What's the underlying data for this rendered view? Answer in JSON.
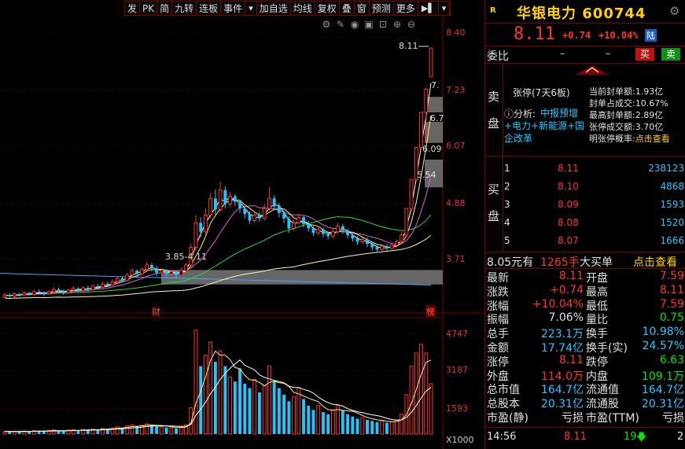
{
  "toolbar": [
    "发",
    "PK",
    "简",
    "九转",
    "连板",
    "事件",
    "▾",
    "加自选",
    "均线",
    "复权",
    "叠",
    "窗",
    "预测",
    "更多",
    "▶▌",
    "▾"
  ],
  "price_axis": [
    "8.40",
    "7.23",
    "6.07",
    "4.88",
    "3.71"
  ],
  "volume_axis": [
    "4747",
    "3187",
    "1593",
    "X1000"
  ],
  "annotations": {
    "peak_price": "8.11",
    "box_label": "3.85-4.11",
    "cai_marker": "财",
    "bang_marker": "榜",
    "labels_right": [
      "7.",
      "6.7",
      "6.09",
      "5.54"
    ]
  },
  "header": {
    "badge": "R",
    "title": "华银电力 600744",
    "price": "8.11",
    "change": "+0.74",
    "change_pct": "+10.04%",
    "board_tag": "陆"
  },
  "weibi": {
    "label": "委比",
    "v1": "–",
    "v2": "–",
    "buy": "买",
    "sell": "卖"
  },
  "sell_panel": {
    "side": [
      "卖",
      "盘"
    ],
    "limit_title": "张停(7天6板)",
    "analysis_prefix": "ⓘ分析:",
    "analysis_text": "中报预增+电力+新能源+国企改革",
    "metrics": [
      {
        "k": "当前封单额",
        "v": "1.93亿"
      },
      {
        "k": "封单占成交",
        "v": "10.67%"
      },
      {
        "k": "最高封单额",
        "v": "2.89亿"
      },
      {
        "k": "张停成交额",
        "v": "3.70亿"
      },
      {
        "k": "明张停概率",
        "v": "点击查看"
      }
    ]
  },
  "buy_panel": {
    "side": [
      "买",
      "盘"
    ],
    "rows": [
      {
        "level": "1",
        "price": "8.11",
        "vol": "238123"
      },
      {
        "level": "2",
        "price": "8.10",
        "vol": "4868"
      },
      {
        "level": "3",
        "price": "8.09",
        "vol": "1593"
      },
      {
        "level": "4",
        "price": "8.08",
        "vol": "1520"
      },
      {
        "level": "5",
        "price": "8.07",
        "vol": "1666"
      }
    ]
  },
  "trade_bar": {
    "price": "8.05元有",
    "qty": "1265手",
    "type": "大买单",
    "link": "点击查看"
  },
  "stats": [
    {
      "l": "最新",
      "lv": "8.11",
      "r": "开盘",
      "rv": "7.59",
      "lc": "red",
      "rc": "red"
    },
    {
      "l": "涨跌",
      "lv": "+0.74",
      "r": "最高",
      "rv": "8.11",
      "lc": "red",
      "rc": "red"
    },
    {
      "l": "涨幅",
      "lv": "+10.04%",
      "r": "最低",
      "rv": "7.59",
      "lc": "red",
      "rc": "red"
    },
    {
      "l": "振幅",
      "lv": "7.06%",
      "r": "量比",
      "rv": "0.75",
      "lc": "white",
      "rc": "green"
    },
    {
      "l": "总手",
      "lv": "223.1万",
      "r": "换手",
      "rv": "10.98%",
      "lc": "cyan",
      "rc": "cyan"
    },
    {
      "l": "金额",
      "lv": "17.74亿",
      "r": "换手(实)",
      "rv": "24.57%",
      "lc": "cyan",
      "rc": "cyan"
    },
    {
      "l": "涨停",
      "lv": "8.11",
      "r": "跌停",
      "rv": "6.63",
      "lc": "red",
      "rc": "green"
    },
    {
      "l": "外盘",
      "lv": "114.0万",
      "r": "内盘",
      "rv": "109.1万",
      "lc": "red",
      "rc": "green"
    },
    {
      "l": "总市值",
      "lv": "164.7亿",
      "r": "流通值",
      "rv": "164.7亿",
      "lc": "cyan",
      "rc": "cyan"
    },
    {
      "l": "总股本",
      "lv": "20.31亿",
      "r": "流通股",
      "rv": "20.31亿",
      "lc": "cyan",
      "rc": "cyan"
    },
    {
      "l": "市盈(静)",
      "lv": "亏损",
      "r": "市盈(TTM)",
      "rv": "亏损",
      "lc": "white",
      "rc": "white"
    }
  ],
  "bottom": {
    "time": "14:56",
    "price": "8.11",
    "vol": "19",
    "count": "2"
  },
  "colors": {
    "up": "#ff3232",
    "down": "#1ec8ff",
    "accent": "#ffd200",
    "border": "#7a0000"
  },
  "chart_data": {
    "type": "candlestick",
    "ylim": [
      3.45,
      8.55
    ],
    "candles": [
      [
        3.62,
        3.66,
        3.6,
        3.7
      ],
      [
        3.66,
        3.64,
        3.61,
        3.69
      ],
      [
        3.64,
        3.68,
        3.62,
        3.71
      ],
      [
        3.68,
        3.66,
        3.63,
        3.7
      ],
      [
        3.66,
        3.7,
        3.64,
        3.73
      ],
      [
        3.7,
        3.67,
        3.64,
        3.72
      ],
      [
        3.67,
        3.72,
        3.65,
        3.75
      ],
      [
        3.72,
        3.7,
        3.67,
        3.76
      ],
      [
        3.7,
        3.68,
        3.64,
        3.73
      ],
      [
        3.68,
        3.72,
        3.66,
        3.75
      ],
      [
        3.72,
        3.76,
        3.7,
        3.8
      ],
      [
        3.76,
        3.73,
        3.7,
        3.79
      ],
      [
        3.73,
        3.7,
        3.66,
        3.76
      ],
      [
        3.7,
        3.75,
        3.68,
        3.78
      ],
      [
        3.75,
        3.78,
        3.72,
        3.82
      ],
      [
        3.78,
        3.74,
        3.7,
        3.8
      ],
      [
        3.74,
        3.79,
        3.72,
        3.82
      ],
      [
        3.79,
        3.76,
        3.72,
        3.83
      ],
      [
        3.76,
        3.82,
        3.74,
        3.85
      ],
      [
        3.82,
        3.8,
        3.76,
        3.86
      ],
      [
        3.8,
        3.86,
        3.78,
        3.9
      ],
      [
        3.86,
        3.84,
        3.8,
        3.9
      ],
      [
        3.84,
        3.9,
        3.82,
        3.94
      ],
      [
        3.9,
        3.96,
        3.88,
        4.0
      ],
      [
        3.96,
        3.92,
        3.88,
        3.99
      ],
      [
        3.92,
        4.02,
        3.9,
        4.06
      ],
      [
        4.02,
        4.1,
        3.98,
        4.14
      ],
      [
        4.1,
        4.04,
        3.98,
        4.12
      ],
      [
        4.04,
        4.12,
        4.02,
        4.16
      ],
      [
        4.12,
        4.2,
        4.08,
        4.26
      ],
      [
        4.2,
        4.14,
        4.08,
        4.24
      ],
      [
        4.14,
        4.06,
        4.0,
        4.18
      ],
      [
        4.06,
        4.1,
        4.02,
        4.14
      ],
      [
        4.1,
        4.04,
        3.98,
        4.12
      ],
      [
        4.04,
        4.08,
        4.0,
        4.12
      ],
      [
        4.08,
        4.02,
        3.96,
        4.1
      ],
      [
        4.02,
        4.1,
        4.0,
        4.16
      ],
      [
        4.1,
        4.2,
        4.06,
        4.24
      ],
      [
        4.2,
        4.52,
        4.16,
        4.58
      ],
      [
        4.52,
        4.96,
        4.46,
        5.1
      ],
      [
        4.96,
        4.8,
        4.7,
        5.06
      ],
      [
        4.8,
        5.1,
        4.76,
        5.22
      ],
      [
        5.1,
        5.4,
        5.04,
        5.5
      ],
      [
        5.4,
        5.2,
        5.1,
        5.56
      ],
      [
        5.2,
        5.55,
        5.16,
        5.7
      ],
      [
        5.55,
        5.3,
        5.22,
        5.62
      ],
      [
        5.3,
        5.44,
        5.24,
        5.52
      ],
      [
        5.44,
        5.34,
        5.26,
        5.48
      ],
      [
        5.34,
        5.22,
        5.14,
        5.38
      ],
      [
        5.22,
        5.12,
        5.04,
        5.26
      ],
      [
        5.12,
        5.0,
        4.94,
        5.18
      ],
      [
        5.0,
        5.1,
        4.96,
        5.16
      ],
      [
        5.1,
        5.04,
        4.98,
        5.16
      ],
      [
        5.04,
        5.22,
        5.0,
        5.3
      ],
      [
        5.22,
        5.4,
        5.18,
        5.6
      ],
      [
        5.4,
        5.26,
        5.18,
        5.46
      ],
      [
        5.26,
        5.14,
        5.06,
        5.32
      ],
      [
        5.14,
        5.04,
        4.96,
        5.18
      ],
      [
        5.04,
        4.86,
        4.78,
        5.08
      ],
      [
        4.86,
        4.96,
        4.82,
        5.02
      ],
      [
        4.96,
        5.06,
        4.92,
        5.12
      ],
      [
        5.06,
        4.94,
        4.88,
        5.1
      ],
      [
        4.94,
        4.86,
        4.8,
        5.0
      ],
      [
        4.86,
        4.78,
        4.72,
        4.9
      ],
      [
        4.78,
        4.84,
        4.74,
        4.9
      ],
      [
        4.84,
        4.76,
        4.7,
        4.88
      ],
      [
        4.76,
        4.72,
        4.66,
        4.8
      ],
      [
        4.72,
        4.8,
        4.68,
        4.86
      ],
      [
        4.8,
        4.9,
        4.76,
        4.96
      ],
      [
        4.9,
        4.82,
        4.76,
        4.94
      ],
      [
        4.82,
        4.74,
        4.68,
        4.86
      ],
      [
        4.74,
        4.68,
        4.62,
        4.78
      ],
      [
        4.68,
        4.62,
        4.56,
        4.72
      ],
      [
        4.62,
        4.66,
        4.58,
        4.7
      ],
      [
        4.66,
        4.58,
        4.52,
        4.7
      ],
      [
        4.58,
        4.52,
        4.46,
        4.62
      ],
      [
        4.52,
        4.48,
        4.42,
        4.56
      ],
      [
        4.48,
        4.54,
        4.44,
        4.58
      ],
      [
        4.54,
        4.5,
        4.46,
        4.58
      ],
      [
        4.5,
        4.56,
        4.48,
        4.6
      ],
      [
        4.56,
        4.62,
        4.52,
        4.66
      ],
      [
        4.62,
        4.74,
        4.58,
        4.8
      ],
      [
        4.74,
        5.22,
        4.7,
        5.22
      ],
      [
        5.22,
        5.74,
        5.18,
        5.74
      ],
      [
        5.74,
        6.32,
        5.7,
        6.32
      ],
      [
        6.32,
        6.95,
        6.28,
        6.95
      ],
      [
        6.95,
        7.37,
        6.4,
        7.4
      ],
      [
        7.59,
        8.11,
        7.59,
        8.11
      ]
    ],
    "volumes": [
      120,
      110,
      130,
      105,
      140,
      115,
      160,
      150,
      130,
      170,
      190,
      150,
      140,
      180,
      200,
      160,
      210,
      190,
      230,
      200,
      260,
      240,
      280,
      330,
      290,
      380,
      420,
      360,
      400,
      470,
      410,
      350,
      330,
      300,
      280,
      260,
      320,
      420,
      1200,
      4747,
      3100,
      3600,
      4200,
      3300,
      3800,
      3100,
      2600,
      2400,
      3000,
      2300,
      2100,
      2500,
      1900,
      2200,
      3100,
      2400,
      2100,
      1800,
      1500,
      1700,
      2100,
      1600,
      1300,
      1100,
      1300,
      1000,
      900,
      1100,
      1300,
      1100,
      900,
      800,
      700,
      750,
      650,
      600,
      550,
      600,
      520,
      560,
      650,
      900,
      1800,
      3100,
      3700,
      4100,
      3700,
      2300
    ]
  }
}
